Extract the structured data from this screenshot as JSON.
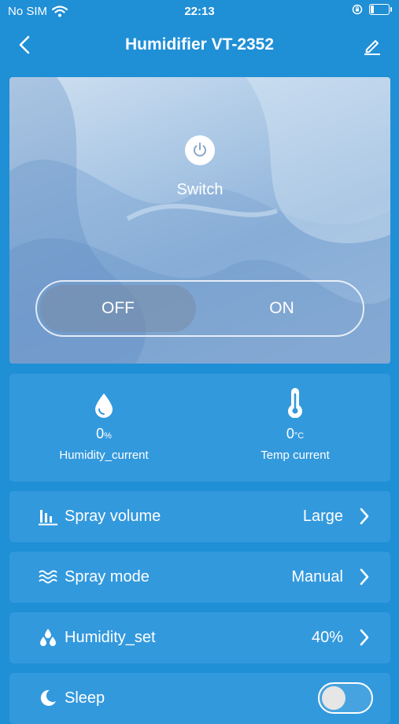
{
  "status": {
    "carrier": "No SIM",
    "time": "22:13"
  },
  "nav": {
    "title": "Humidifier VT-2352"
  },
  "power": {
    "label": "Switch",
    "off": "OFF",
    "on": "ON",
    "state": "OFF"
  },
  "readings": [
    {
      "value": "0",
      "unit": "%",
      "label": "Humidity_current",
      "icon": "water-drop-icon"
    },
    {
      "value": "0",
      "unit": "°C",
      "label": "Temp current",
      "icon": "thermometer-icon"
    }
  ],
  "settings": [
    {
      "label": "Spray volume",
      "value": "Large",
      "icon": "bar-chart-icon"
    },
    {
      "label": "Spray mode",
      "value": "Manual",
      "icon": "waves-icon"
    },
    {
      "label": "Humidity_set",
      "value": "40%",
      "icon": "drops-icon"
    }
  ],
  "sleep": {
    "label": "Sleep",
    "icon": "moon-icon",
    "enabled": false
  },
  "colors": {
    "background": "#1f8fd6",
    "card": "#3399dd"
  }
}
